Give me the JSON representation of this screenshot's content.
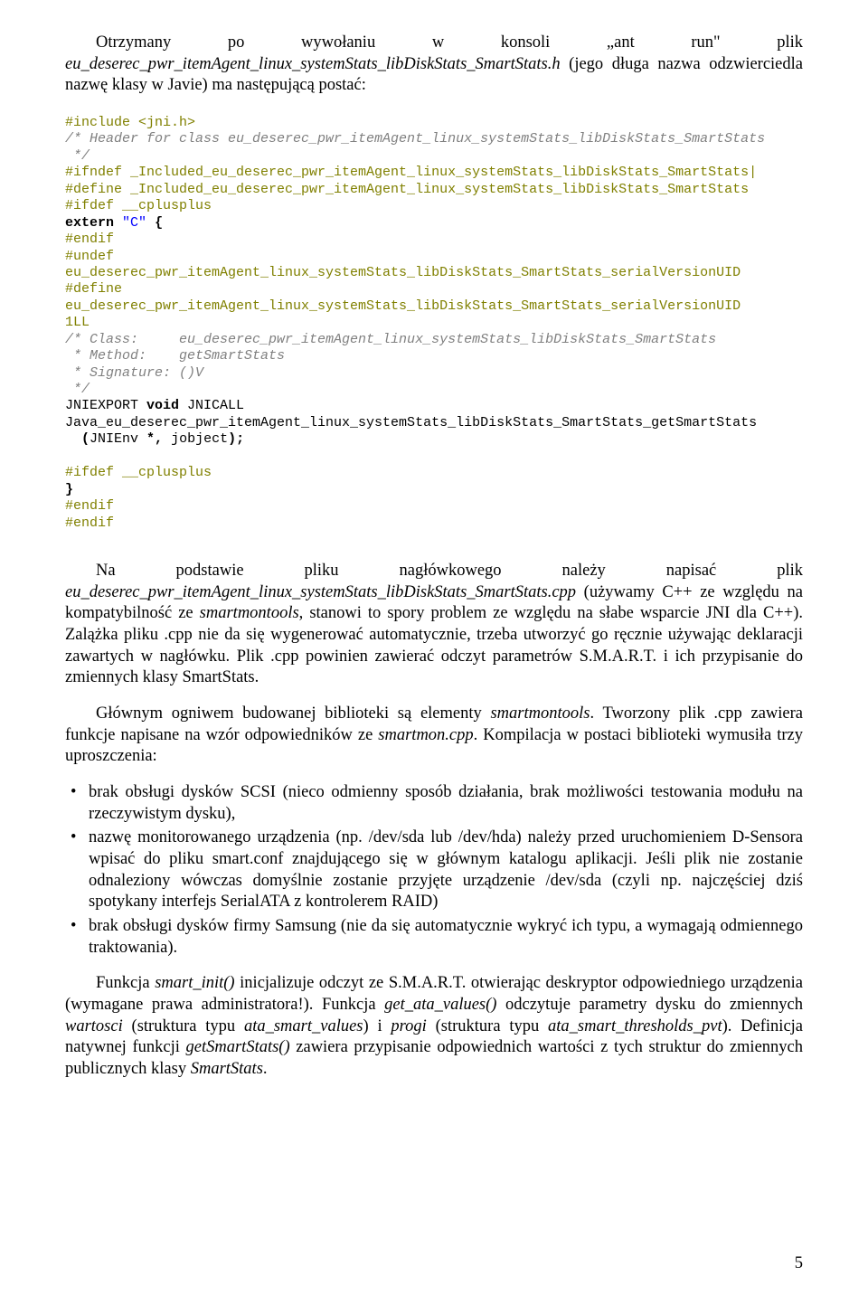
{
  "para_intro": "Otrzymany po wywołaniu w konsoli „ant run\" plik <i>eu_deserec_pwr_itemAgent_linux_systemStats_libDiskStats_SmartStats.h</i> (jego długa nazwa odzwierciedla nazwę klasy w Javie) ma następującą postać:",
  "code_lines": [
    {
      "segs": [
        {
          "c": "c-preproc",
          "t": "#include <jni.h>"
        }
      ]
    },
    {
      "segs": [
        {
          "c": "c-comment",
          "t": "/* Header for class eu_deserec_pwr_itemAgent_linux_systemStats_libDiskStats_SmartStats"
        }
      ]
    },
    {
      "segs": [
        {
          "c": "c-comment",
          "t": " */"
        }
      ]
    },
    {
      "segs": [
        {
          "c": "c-preproc",
          "t": "#ifndef _Included_eu_deserec_pwr_itemAgent_linux_systemStats_libDiskStats_SmartStats|"
        }
      ]
    },
    {
      "segs": [
        {
          "c": "c-preproc",
          "t": "#define _Included_eu_deserec_pwr_itemAgent_linux_systemStats_libDiskStats_SmartStats"
        }
      ]
    },
    {
      "segs": [
        {
          "c": "c-preproc",
          "t": "#ifdef __cplusplus"
        }
      ]
    },
    {
      "segs": [
        {
          "c": "c-keyword",
          "t": "extern"
        },
        {
          "c": "",
          "t": " "
        },
        {
          "c": "c-string",
          "t": "\"C\""
        },
        {
          "c": "",
          "t": " "
        },
        {
          "c": "c-op",
          "t": "{"
        }
      ]
    },
    {
      "segs": [
        {
          "c": "c-preproc",
          "t": "#endif"
        }
      ]
    },
    {
      "segs": [
        {
          "c": "c-preproc",
          "t": "#undef"
        }
      ]
    },
    {
      "segs": [
        {
          "c": "c-preproc",
          "t": "eu_deserec_pwr_itemAgent_linux_systemStats_libDiskStats_SmartStats_serialVersionUID"
        }
      ]
    },
    {
      "segs": [
        {
          "c": "c-preproc",
          "t": "#define"
        }
      ]
    },
    {
      "segs": [
        {
          "c": "c-preproc",
          "t": "eu_deserec_pwr_itemAgent_linux_systemStats_libDiskStats_SmartStats_serialVersionUID"
        }
      ]
    },
    {
      "segs": [
        {
          "c": "c-preproc",
          "t": "1LL"
        }
      ]
    },
    {
      "segs": [
        {
          "c": "c-comment",
          "t": "/* Class:     eu_deserec_pwr_itemAgent_linux_systemStats_libDiskStats_SmartStats"
        }
      ]
    },
    {
      "segs": [
        {
          "c": "c-comment",
          "t": " * Method:    getSmartStats"
        }
      ]
    },
    {
      "segs": [
        {
          "c": "c-comment",
          "t": " * Signature: ()V"
        }
      ]
    },
    {
      "segs": [
        {
          "c": "c-comment",
          "t": " */"
        }
      ]
    },
    {
      "segs": [
        {
          "c": "",
          "t": "JNIEXPORT "
        },
        {
          "c": "c-keyword",
          "t": "void"
        },
        {
          "c": "",
          "t": " JNICALL"
        }
      ]
    },
    {
      "segs": [
        {
          "c": "",
          "t": "Java_eu_deserec_pwr_itemAgent_linux_systemStats_libDiskStats_SmartStats_getSmartStats"
        }
      ]
    },
    {
      "segs": [
        {
          "c": "",
          "t": "  "
        },
        {
          "c": "c-op",
          "t": "("
        },
        {
          "c": "",
          "t": "JNIEnv "
        },
        {
          "c": "c-op",
          "t": "*,"
        },
        {
          "c": "",
          "t": " jobject"
        },
        {
          "c": "c-op",
          "t": ");"
        }
      ]
    },
    {
      "segs": [
        {
          "c": "",
          "t": ""
        }
      ]
    },
    {
      "segs": [
        {
          "c": "c-preproc",
          "t": "#ifdef __cplusplus"
        }
      ]
    },
    {
      "segs": [
        {
          "c": "c-op",
          "t": "}"
        }
      ]
    },
    {
      "segs": [
        {
          "c": "c-preproc",
          "t": "#endif"
        }
      ]
    },
    {
      "segs": [
        {
          "c": "c-preproc",
          "t": "#endif"
        }
      ]
    }
  ],
  "para_after_code": "Na podstawie pliku nagłówkowego należy napisać plik <i>eu_deserec_pwr_itemAgent_linux_systemStats_libDiskStats_SmartStats.cpp</i> (używamy C++ ze względu na kompatybilność ze <i>smartmontools</i>, stanowi to spory problem ze względu na słabe wsparcie JNI dla C++). Zalążka pliku .cpp nie da się wygenerować automatycznie, trzeba utworzyć go ręcznie używając deklaracji zawartych w nagłówku. Plik .cpp powinien zawierać odczyt parametrów S.M.A.R.T. i ich przypisanie do zmiennych klasy SmartStats.",
  "para_lib": "Głównym ogniwem budowanej biblioteki są elementy <i>smartmontools</i>. Tworzony plik .cpp zawiera funkcje napisane na wzór odpowiedników ze <i>smartmon.cpp</i>. Kompilacja w postaci biblioteki wymusiła trzy uproszczenia:",
  "bullets": [
    "brak obsługi dysków SCSI (nieco odmienny sposób działania, brak możliwości testowania modułu na rzeczywistym dysku),",
    "nazwę monitorowanego urządzenia (np. /dev/sda lub /dev/hda) należy przed uruchomieniem D-Sensora wpisać do pliku smart.conf znajdującego się w głównym katalogu aplikacji. Jeśli plik nie zostanie odnaleziony wówczas domyślnie zostanie przyjęte urządzenie /dev/sda (czyli np. najczęściej dziś spotykany interfejs SerialATA z kontrolerem RAID)",
    "brak obsługi dysków firmy Samsung (nie da się automatycznie wykryć ich typu, a wymagają odmiennego traktowania)."
  ],
  "para_smart_init": "Funkcja <i>smart_init()</i> inicjalizuje odczyt ze S.M.A.R.T. otwierając deskryptor odpowiedniego urządzenia (wymagane prawa administratora!). Funkcja <i>get_ata_values()</i> odczytuje parametry dysku do zmiennych <i>wartosci</i> (struktura typu <i>ata_smart_values</i>) i <i>progi</i> (struktura typu <i>ata_smart_thresholds_pvt</i>). Definicja natywnej funkcji <i>getSmartStats()</i> zawiera przypisanie odpowiednich wartości z tych struktur do zmiennych publicznych klasy <i>SmartStats</i>.",
  "page_number": "5"
}
